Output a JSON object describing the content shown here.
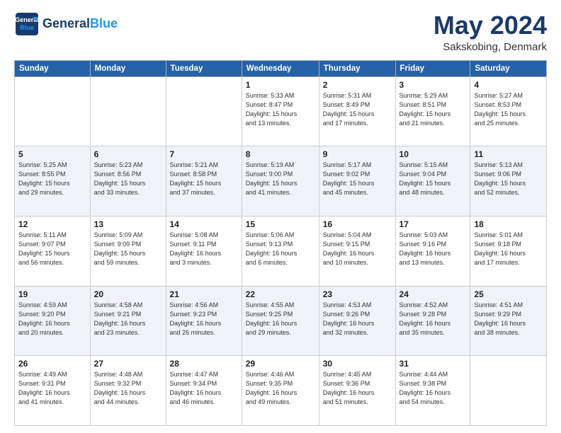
{
  "logo": {
    "line1": "General",
    "line2": "Blue"
  },
  "title": "May 2024",
  "subtitle": "Sakskobing, Denmark",
  "days_of_week": [
    "Sunday",
    "Monday",
    "Tuesday",
    "Wednesday",
    "Thursday",
    "Friday",
    "Saturday"
  ],
  "weeks": [
    [
      {
        "day": "",
        "info": ""
      },
      {
        "day": "",
        "info": ""
      },
      {
        "day": "",
        "info": ""
      },
      {
        "day": "1",
        "info": "Sunrise: 5:33 AM\nSunset: 8:47 PM\nDaylight: 15 hours\nand 13 minutes."
      },
      {
        "day": "2",
        "info": "Sunrise: 5:31 AM\nSunset: 8:49 PM\nDaylight: 15 hours\nand 17 minutes."
      },
      {
        "day": "3",
        "info": "Sunrise: 5:29 AM\nSunset: 8:51 PM\nDaylight: 15 hours\nand 21 minutes."
      },
      {
        "day": "4",
        "info": "Sunrise: 5:27 AM\nSunset: 8:53 PM\nDaylight: 15 hours\nand 25 minutes."
      }
    ],
    [
      {
        "day": "5",
        "info": "Sunrise: 5:25 AM\nSunset: 8:55 PM\nDaylight: 15 hours\nand 29 minutes."
      },
      {
        "day": "6",
        "info": "Sunrise: 5:23 AM\nSunset: 8:56 PM\nDaylight: 15 hours\nand 33 minutes."
      },
      {
        "day": "7",
        "info": "Sunrise: 5:21 AM\nSunset: 8:58 PM\nDaylight: 15 hours\nand 37 minutes."
      },
      {
        "day": "8",
        "info": "Sunrise: 5:19 AM\nSunset: 9:00 PM\nDaylight: 15 hours\nand 41 minutes."
      },
      {
        "day": "9",
        "info": "Sunrise: 5:17 AM\nSunset: 9:02 PM\nDaylight: 15 hours\nand 45 minutes."
      },
      {
        "day": "10",
        "info": "Sunrise: 5:15 AM\nSunset: 9:04 PM\nDaylight: 15 hours\nand 48 minutes."
      },
      {
        "day": "11",
        "info": "Sunrise: 5:13 AM\nSunset: 9:06 PM\nDaylight: 15 hours\nand 52 minutes."
      }
    ],
    [
      {
        "day": "12",
        "info": "Sunrise: 5:11 AM\nSunset: 9:07 PM\nDaylight: 15 hours\nand 56 minutes."
      },
      {
        "day": "13",
        "info": "Sunrise: 5:09 AM\nSunset: 9:09 PM\nDaylight: 15 hours\nand 59 minutes."
      },
      {
        "day": "14",
        "info": "Sunrise: 5:08 AM\nSunset: 9:11 PM\nDaylight: 16 hours\nand 3 minutes."
      },
      {
        "day": "15",
        "info": "Sunrise: 5:06 AM\nSunset: 9:13 PM\nDaylight: 16 hours\nand 6 minutes."
      },
      {
        "day": "16",
        "info": "Sunrise: 5:04 AM\nSunset: 9:15 PM\nDaylight: 16 hours\nand 10 minutes."
      },
      {
        "day": "17",
        "info": "Sunrise: 5:03 AM\nSunset: 9:16 PM\nDaylight: 16 hours\nand 13 minutes."
      },
      {
        "day": "18",
        "info": "Sunrise: 5:01 AM\nSunset: 9:18 PM\nDaylight: 16 hours\nand 17 minutes."
      }
    ],
    [
      {
        "day": "19",
        "info": "Sunrise: 4:59 AM\nSunset: 9:20 PM\nDaylight: 16 hours\nand 20 minutes."
      },
      {
        "day": "20",
        "info": "Sunrise: 4:58 AM\nSunset: 9:21 PM\nDaylight: 16 hours\nand 23 minutes."
      },
      {
        "day": "21",
        "info": "Sunrise: 4:56 AM\nSunset: 9:23 PM\nDaylight: 16 hours\nand 26 minutes."
      },
      {
        "day": "22",
        "info": "Sunrise: 4:55 AM\nSunset: 9:25 PM\nDaylight: 16 hours\nand 29 minutes."
      },
      {
        "day": "23",
        "info": "Sunrise: 4:53 AM\nSunset: 9:26 PM\nDaylight: 16 hours\nand 32 minutes."
      },
      {
        "day": "24",
        "info": "Sunrise: 4:52 AM\nSunset: 9:28 PM\nDaylight: 16 hours\nand 35 minutes."
      },
      {
        "day": "25",
        "info": "Sunrise: 4:51 AM\nSunset: 9:29 PM\nDaylight: 16 hours\nand 38 minutes."
      }
    ],
    [
      {
        "day": "26",
        "info": "Sunrise: 4:49 AM\nSunset: 9:31 PM\nDaylight: 16 hours\nand 41 minutes."
      },
      {
        "day": "27",
        "info": "Sunrise: 4:48 AM\nSunset: 9:32 PM\nDaylight: 16 hours\nand 44 minutes."
      },
      {
        "day": "28",
        "info": "Sunrise: 4:47 AM\nSunset: 9:34 PM\nDaylight: 16 hours\nand 46 minutes."
      },
      {
        "day": "29",
        "info": "Sunrise: 4:46 AM\nSunset: 9:35 PM\nDaylight: 16 hours\nand 49 minutes."
      },
      {
        "day": "30",
        "info": "Sunrise: 4:45 AM\nSunset: 9:36 PM\nDaylight: 16 hours\nand 51 minutes."
      },
      {
        "day": "31",
        "info": "Sunrise: 4:44 AM\nSunset: 9:38 PM\nDaylight: 16 hours\nand 54 minutes."
      },
      {
        "day": "",
        "info": ""
      }
    ]
  ]
}
